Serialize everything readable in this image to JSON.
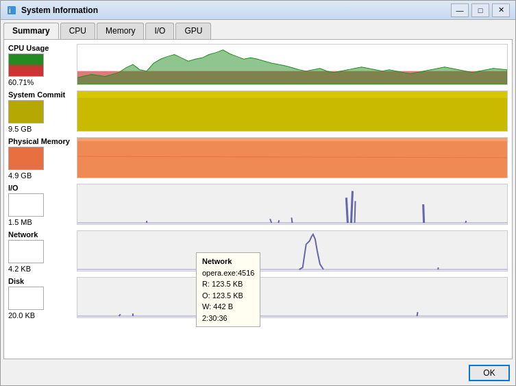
{
  "window": {
    "title": "System Information",
    "minimize_label": "—",
    "maximize_label": "□",
    "close_label": "✕"
  },
  "tabs": [
    {
      "label": "Summary",
      "active": true
    },
    {
      "label": "CPU",
      "active": false
    },
    {
      "label": "Memory",
      "active": false
    },
    {
      "label": "I/O",
      "active": false
    },
    {
      "label": "GPU",
      "active": false
    }
  ],
  "sections": [
    {
      "label": "CPU Usage",
      "value": "60.71%",
      "chart_type": "cpu"
    },
    {
      "label": "System Commit",
      "value": "9.5 GB",
      "chart_type": "commit"
    },
    {
      "label": "Physical Memory",
      "value": "4.9 GB",
      "chart_type": "memory"
    },
    {
      "label": "I/O",
      "value": "1.5  MB",
      "chart_type": "io"
    },
    {
      "label": "Network",
      "value": "4.2  KB",
      "chart_type": "network"
    },
    {
      "label": "Disk",
      "value": "20.0  KB",
      "chart_type": "disk"
    }
  ],
  "tooltip": {
    "title": "Network",
    "line1": "opera.exe:4516",
    "line2": "R: 123.5  KB",
    "line3": "O: 123.5  KB",
    "line4": "W: 442 B",
    "line5": "2:30:36"
  },
  "footer": {
    "ok_label": "OK"
  }
}
